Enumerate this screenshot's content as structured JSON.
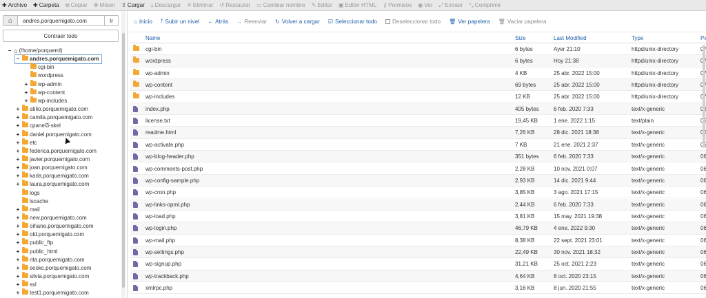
{
  "toolbar": {
    "items": [
      {
        "icon": "plus-icon",
        "label": "Archivo",
        "enabled": true
      },
      {
        "icon": "plus-icon",
        "label": "Carpeta",
        "enabled": true
      },
      {
        "icon": "copy-icon",
        "label": "Copiar",
        "enabled": false
      },
      {
        "icon": "move-icon",
        "label": "Mover",
        "enabled": false
      },
      {
        "icon": "upload-icon",
        "label": "Cargar",
        "enabled": true
      },
      {
        "icon": "download-icon",
        "label": "Descargar",
        "enabled": false
      },
      {
        "icon": "close-icon",
        "label": "Eliminar",
        "enabled": false
      },
      {
        "icon": "restore-icon",
        "label": "Restaurar",
        "enabled": false
      },
      {
        "icon": "rename-icon",
        "label": "Cambiar nombre",
        "enabled": false
      },
      {
        "icon": "pencil-icon",
        "label": "Editar",
        "enabled": false
      },
      {
        "icon": "html-editor-icon",
        "label": "Editor HTML",
        "enabled": false
      },
      {
        "icon": "key-icon",
        "label": "Permisos",
        "enabled": false
      },
      {
        "icon": "eye-icon",
        "label": "Ver",
        "enabled": false
      },
      {
        "icon": "extract-icon",
        "label": "Extraer",
        "enabled": false
      },
      {
        "icon": "compress-icon",
        "label": "Comprimir",
        "enabled": false
      }
    ]
  },
  "sidebar": {
    "path_value": "andres.porquemigato.com",
    "go_label": "Ir",
    "collapse_label": "Contraer todo",
    "tree": [
      {
        "toggle": "−",
        "label": "(/home/porqueml)",
        "depth": 0,
        "home": true
      },
      {
        "toggle": "−",
        "label": "andres.porquemigato.com",
        "depth": 1,
        "selected": true
      },
      {
        "toggle": "",
        "label": "cgi-bin",
        "depth": 2
      },
      {
        "toggle": "",
        "label": "wordpress",
        "depth": 2
      },
      {
        "toggle": "+",
        "label": "wp-admin",
        "depth": 2
      },
      {
        "toggle": "+",
        "label": "wp-content",
        "depth": 2
      },
      {
        "toggle": "+",
        "label": "wp-includes",
        "depth": 2
      },
      {
        "toggle": "+",
        "label": "atilio.porquemigato.com",
        "depth": 1
      },
      {
        "toggle": "+",
        "label": "camila.porquemigato.com",
        "depth": 1
      },
      {
        "toggle": "+",
        "label": "cpanel3-skel",
        "depth": 1
      },
      {
        "toggle": "+",
        "label": "daniel.porquemigato.com",
        "depth": 1
      },
      {
        "toggle": "+",
        "label": "etc",
        "depth": 1
      },
      {
        "toggle": "+",
        "label": "federica.porquemigato.com",
        "depth": 1
      },
      {
        "toggle": "+",
        "label": "javier.porquemigato.com",
        "depth": 1
      },
      {
        "toggle": "+",
        "label": "joan.porquemigato.com",
        "depth": 1
      },
      {
        "toggle": "+",
        "label": "karla.porquemigato.com",
        "depth": 1
      },
      {
        "toggle": "+",
        "label": "laura.porquemigato.com",
        "depth": 1
      },
      {
        "toggle": "",
        "label": "logs",
        "depth": 1
      },
      {
        "toggle": "",
        "label": "lscache",
        "depth": 1
      },
      {
        "toggle": "+",
        "label": "mail",
        "depth": 1
      },
      {
        "toggle": "+",
        "label": "new.porquemigato.com",
        "depth": 1
      },
      {
        "toggle": "+",
        "label": "oihane.porquemigato.com",
        "depth": 1
      },
      {
        "toggle": "+",
        "label": "old.porquemigato.com",
        "depth": 1
      },
      {
        "toggle": "+",
        "label": "public_ftp",
        "depth": 1
      },
      {
        "toggle": "+",
        "label": "public_html",
        "depth": 1
      },
      {
        "toggle": "+",
        "label": "rita.porquemigato.com",
        "depth": 1
      },
      {
        "toggle": "+",
        "label": "seokc.porquemigato.com",
        "depth": 1
      },
      {
        "toggle": "+",
        "label": "silvia.porquemigato.com",
        "depth": 1
      },
      {
        "toggle": "+",
        "label": "ssl",
        "depth": 1
      },
      {
        "toggle": "+",
        "label": "test1.porquemigato.com",
        "depth": 1
      }
    ]
  },
  "actions": [
    {
      "icon": "home-icon",
      "label": "Inicio",
      "enabled": true
    },
    {
      "icon": "level-up-icon",
      "label": "Subir un nivel",
      "enabled": true
    },
    {
      "icon": "back-arrow-icon",
      "label": "Atrás",
      "enabled": true
    },
    {
      "icon": "forward-arrow-icon",
      "label": "Reenviar",
      "enabled": false
    },
    {
      "icon": "refresh-icon",
      "label": "Volver a cargar",
      "enabled": true
    },
    {
      "icon": "check-square-icon",
      "label": "Seleccionar todo",
      "enabled": true
    },
    {
      "icon": "empty-square-icon",
      "label": "Deseleccionar todo",
      "enabled": false
    },
    {
      "icon": "trash-icon",
      "label": "Ver papelera",
      "enabled": true
    },
    {
      "icon": "trash-icon",
      "label": "Vaciar papelera",
      "enabled": false
    }
  ],
  "table": {
    "headers": {
      "name": "Name",
      "size": "Size",
      "modified": "Last Modified",
      "type": "Type",
      "perms": "Pe"
    },
    "rows": [
      {
        "kind": "folder",
        "name": "cgi-bin",
        "size": "6 bytes",
        "modified": "Ayer 21:10",
        "type": "httpd/unix-directory",
        "perms": "07"
      },
      {
        "kind": "folder",
        "name": "wordpress",
        "size": "6 bytes",
        "modified": "Hoy 21:38",
        "type": "httpd/unix-directory",
        "perms": "07"
      },
      {
        "kind": "folder",
        "name": "wp-admin",
        "size": "4 KB",
        "modified": "25 abr. 2022 15:00",
        "type": "httpd/unix-directory",
        "perms": "07"
      },
      {
        "kind": "folder",
        "name": "wp-content",
        "size": "69 bytes",
        "modified": "25 abr. 2022 15:00",
        "type": "httpd/unix-directory",
        "perms": "07"
      },
      {
        "kind": "folder",
        "name": "wp-includes",
        "size": "12 KB",
        "modified": "25 abr. 2022 15:00",
        "type": "httpd/unix-directory",
        "perms": "07"
      },
      {
        "kind": "file",
        "name": "index.php",
        "size": "405 bytes",
        "modified": "6 feb. 2020 7:33",
        "type": "text/x-generic",
        "perms": "06"
      },
      {
        "kind": "file",
        "name": "license.txt",
        "size": "19,45 KB",
        "modified": "1 ene. 2022 1:15",
        "type": "text/plain",
        "perms": "06"
      },
      {
        "kind": "file",
        "name": "readme.html",
        "size": "7,26 KB",
        "modified": "28 dic. 2021 18:38",
        "type": "text/x-generic",
        "perms": "06"
      },
      {
        "kind": "file",
        "name": "wp-activate.php",
        "size": "7 KB",
        "modified": "21 ene. 2021 2:37",
        "type": "text/x-generic",
        "perms": "06"
      },
      {
        "kind": "file",
        "name": "wp-blog-header.php",
        "size": "351 bytes",
        "modified": "6 feb. 2020 7:33",
        "type": "text/x-generic",
        "perms": "06"
      },
      {
        "kind": "file",
        "name": "wp-comments-post.php",
        "size": "2,28 KB",
        "modified": "10 nov. 2021 0:07",
        "type": "text/x-generic",
        "perms": "06"
      },
      {
        "kind": "file",
        "name": "wp-config-sample.php",
        "size": "2,93 KB",
        "modified": "14 dic. 2021 9:44",
        "type": "text/x-generic",
        "perms": "06"
      },
      {
        "kind": "file",
        "name": "wp-cron.php",
        "size": "3,85 KB",
        "modified": "3 ago. 2021 17:15",
        "type": "text/x-generic",
        "perms": "06"
      },
      {
        "kind": "file",
        "name": "wp-links-opml.php",
        "size": "2,44 KB",
        "modified": "6 feb. 2020 7:33",
        "type": "text/x-generic",
        "perms": "06"
      },
      {
        "kind": "file",
        "name": "wp-load.php",
        "size": "3,81 KB",
        "modified": "15 may. 2021 19:38",
        "type": "text/x-generic",
        "perms": "06"
      },
      {
        "kind": "file",
        "name": "wp-login.php",
        "size": "46,79 KB",
        "modified": "4 ene. 2022 9:30",
        "type": "text/x-generic",
        "perms": "06"
      },
      {
        "kind": "file",
        "name": "wp-mail.php",
        "size": "8,38 KB",
        "modified": "22 sept. 2021 23:01",
        "type": "text/x-generic",
        "perms": "06"
      },
      {
        "kind": "file",
        "name": "wp-settings.php",
        "size": "22,49 KB",
        "modified": "30 nov. 2021 18:32",
        "type": "text/x-generic",
        "perms": "06"
      },
      {
        "kind": "file",
        "name": "wp-signup.php",
        "size": "31,21 KB",
        "modified": "25 oct. 2021 2:23",
        "type": "text/x-generic",
        "perms": "06"
      },
      {
        "kind": "file",
        "name": "wp-trackback.php",
        "size": "4,64 KB",
        "modified": "8 oct. 2020 23:15",
        "type": "text/x-generic",
        "perms": "06"
      },
      {
        "kind": "file",
        "name": "xmlrpc.php",
        "size": "3,16 KB",
        "modified": "8 jun. 2020 21:55",
        "type": "text/x-generic",
        "perms": "06"
      }
    ]
  },
  "colors": {
    "link": "#1f5faa",
    "folder": "#f4a834",
    "file": "#6f6aa6",
    "disabled": "#9a9a9a"
  }
}
